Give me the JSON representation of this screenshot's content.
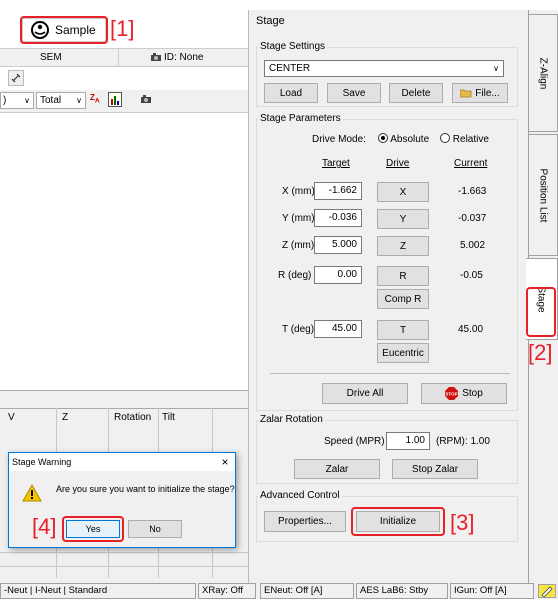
{
  "left": {
    "sample_label": "Sample",
    "sem_header": "SEM",
    "id_label": "ID: None",
    "total_label": "Total",
    "columns": [
      "V",
      "Z",
      "Rotation",
      "Tilt"
    ]
  },
  "dialog": {
    "title": "Stage Warning",
    "message": "Are you sure you want to initialize the stage?",
    "yes": "Yes",
    "no": "No"
  },
  "stage": {
    "title": "Stage",
    "settings_legend": "Stage Settings",
    "preset": "CENTER",
    "load": "Load",
    "save": "Save",
    "delete": "Delete",
    "file": "File...",
    "params_legend": "Stage Parameters",
    "drive_mode_label": "Drive Mode:",
    "absolute": "Absolute",
    "relative": "Relative",
    "col_target": "Target",
    "col_drive": "Drive",
    "col_current": "Current",
    "axes": [
      {
        "label": "X (mm)",
        "target": "-1.662",
        "drive": "X",
        "current": "-1.663"
      },
      {
        "label": "Y (mm)",
        "target": "-0.036",
        "drive": "Y",
        "current": "-0.037"
      },
      {
        "label": "Z (mm)",
        "target": "5.000",
        "drive": "Z",
        "current": "5.002"
      },
      {
        "label": "R (deg)",
        "target": "0.00",
        "drive": "R",
        "current": "-0.05"
      },
      {
        "label": "T (deg)",
        "target": "45.00",
        "drive": "T",
        "current": "45.00"
      }
    ],
    "comp_r": "Comp R",
    "eucentric": "Eucentric",
    "drive_all": "Drive All",
    "stop": "Stop",
    "stop_icon_text": "STOP",
    "zalar_legend": "Zalar Rotation",
    "speed_label": "Speed (MPR)",
    "speed_value": "1.00",
    "rpm_label": "(RPM): 1.00",
    "zalar": "Zalar",
    "stop_zalar": "Stop Zalar",
    "adv_legend": "Advanced Control",
    "properties": "Properties...",
    "initialize": "Initialize"
  },
  "tabs": [
    "Z-Align",
    "Position List",
    "Stage"
  ],
  "status": [
    "-Neut | I-Neut | Standard",
    "XRay: Off",
    "ENeut: Off [A]",
    "AES LaB6: Stby",
    "IGun: Off [A]"
  ],
  "annotations": [
    "[1]",
    "[2]",
    "[3]",
    "[4]"
  ],
  "colors": {
    "annotation_red": "#e8202a",
    "panel_bg": "#f0f0f0",
    "dialog_border": "#0078d7"
  }
}
